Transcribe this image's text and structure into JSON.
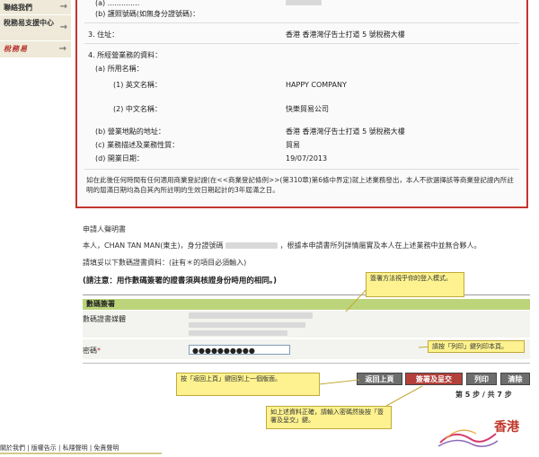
{
  "sidebar": {
    "items": [
      {
        "label": "聯絡我們",
        "arrow": "→"
      },
      {
        "label": "稅務易支援中心",
        "arrow": "→"
      },
      {
        "label": "稅務易",
        "arrow": "→"
      }
    ]
  },
  "form": {
    "id_row": {
      "label": "(b) 護照號碼(如無身分證號碼)："
    },
    "address": {
      "label": "3. 住址：",
      "value": "香港 香港灣仔告士打道 5 號稅務大樓"
    },
    "business_title": "4. 所經營業務的資料：",
    "name_title": "(a) 所用名稱：",
    "english_name": {
      "label": "(1) 英文名稱：",
      "value": "HAPPY COMPANY"
    },
    "chinese_name": {
      "label": "(2) 中文名稱：",
      "value": "快樂貿易公司"
    },
    "business_address": {
      "label": "(b) 營業地點的地址：",
      "value": "香港 香港灣仔告士打道 5 號稅務大樓"
    },
    "nature": {
      "label": "(c) 業務描述及業務性質：",
      "value": "貿易"
    },
    "commence": {
      "label": "(d) 開業日期：",
      "value": "19/07/2013"
    },
    "notice": "如在此後任何時間有任何適用商業登記證(在<<商業登記條例>>(第310章)第6條中界定)就上述業務發出，本人不欲選擇該等商業登記證內所註明的屆滿日期均為自其內所註明的生效日期起計的3年屆滿之日。"
  },
  "declaration": {
    "title": "申請人聲明書",
    "body_prefix": "本人，CHAN TAN MAN(東主)，身分證號碼",
    "body_suffix": "，根據本申請書所列詳情屬實及本人在上述業務中並無合夥人。",
    "instruction": "請填妥以下數碼證書資料：(註有＊的項目必須輸入)",
    "note": "(請注意：用作數碼簽署的證書須與核證身份時用的相同。)"
  },
  "signature": {
    "header": "數碼簽署",
    "cert_label": "數碼證書媒體",
    "password_label": "密碼",
    "required_mark": "*",
    "password_value": "●●●●●●●●●●"
  },
  "buttons": {
    "back": "返回上頁",
    "sign": "簽署及呈交",
    "print": "列印",
    "clear": "清除"
  },
  "step": "第 5 步 / 共 7 步",
  "callouts": {
    "sign_method": "簽署方法視乎你的登入模式。",
    "print": "請按「列印」鍵列印本頁。",
    "back": "按「返回上頁」鍵回到上一個版面。",
    "submit": "如上述資料正確，請輸入密碼然後按「簽署及呈交」鍵。"
  },
  "logo": {
    "text": "香港"
  },
  "footer": {
    "links": "關於我們 | 版權告示 | 私隱聲明 | 免責聲明"
  },
  "colors": {
    "accent_red": "#c4342e",
    "sig_header_green": "#bcd47a",
    "callout_yellow": "#fdf28f",
    "button_gray": "#6d6d6d",
    "button_red": "#b3403a"
  }
}
